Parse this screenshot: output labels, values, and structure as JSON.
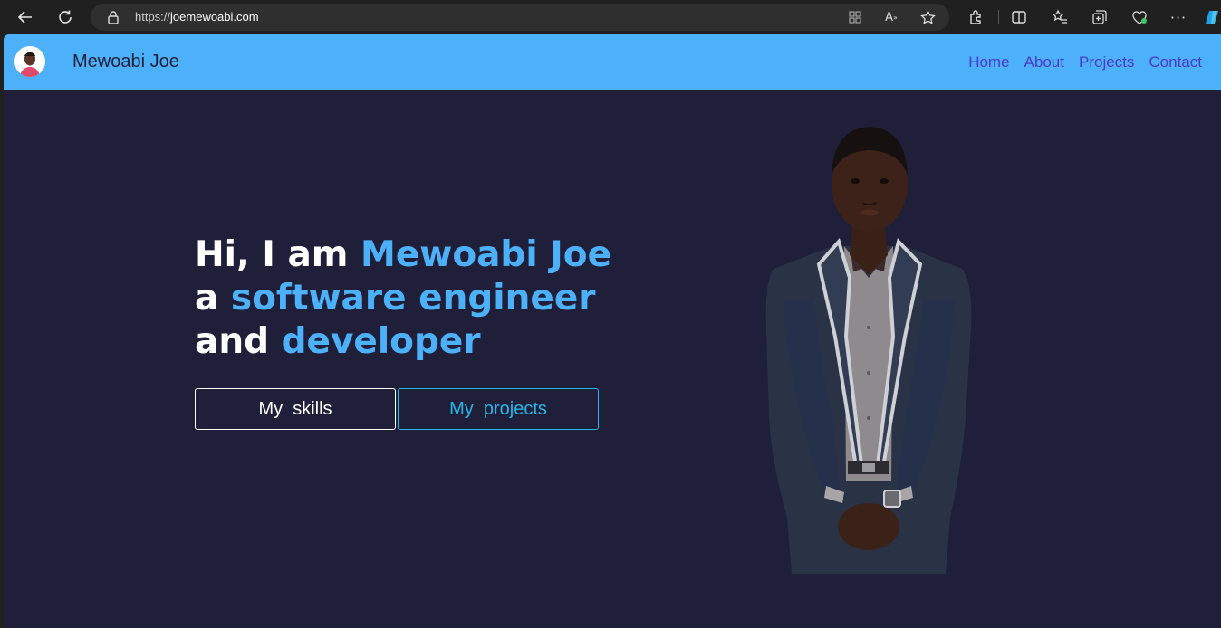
{
  "browser": {
    "url_scheme": "https://",
    "url_host": "joemewoabi.com"
  },
  "site": {
    "brand": "Mewoabi Joe",
    "nav": [
      "Home",
      "About",
      "Projects",
      "Contact"
    ]
  },
  "hero": {
    "line1_plain": "Hi, I am ",
    "line1_highlight": "Mewoabi Joe",
    "line2_plain": "a ",
    "line2_highlight": "software engineer",
    "line3_plain": "and ",
    "line3_highlight": "developer",
    "skills_label": "My  skills",
    "projects_label": "My  projects"
  },
  "colors": {
    "nav_bg": "#4db0fb",
    "page_bg": "#1f1f39",
    "accent": "#4db0fb",
    "nav_link": "#4d3bc6",
    "projects_btn": "#27b6e8"
  }
}
